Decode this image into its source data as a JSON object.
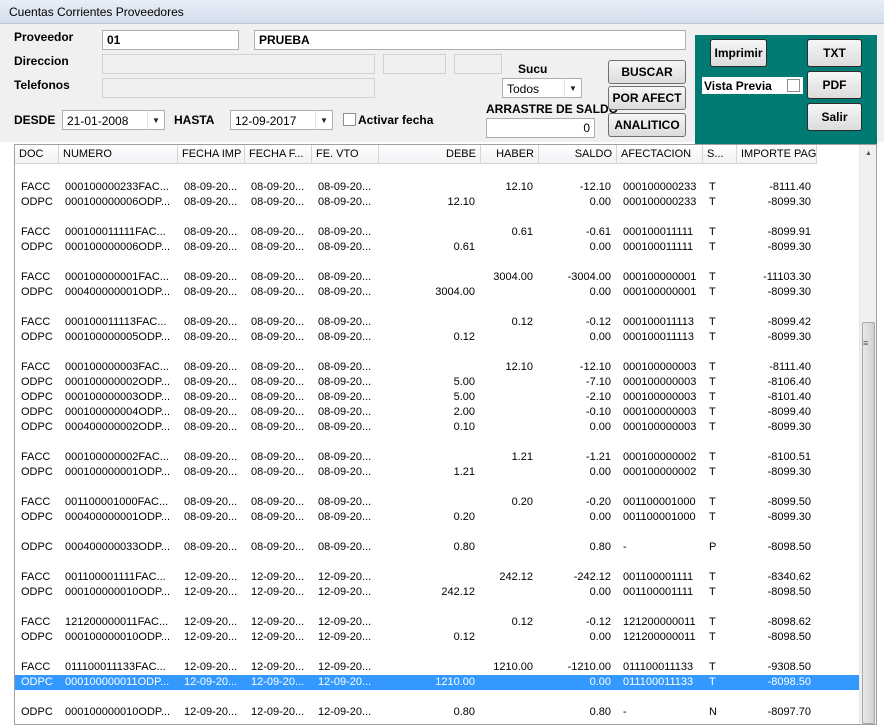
{
  "window": {
    "title": "Cuentas Corrientes Proveedores"
  },
  "form": {
    "proveedor_label": "Proveedor",
    "proveedor_code": "01",
    "proveedor_name": "PRUEBA",
    "direccion_label": "Direccion",
    "telefonos_label": "Telefonos",
    "sucu_label": "Sucu",
    "sucu_value": "Todos",
    "desde_label": "DESDE",
    "desde_value": "21-01-2008",
    "hasta_label": "HASTA",
    "hasta_value": "12-09-2017",
    "activar_fecha_label": "Activar fecha",
    "arrastre_label": "ARRASTRE DE SALDO",
    "arrastre_value": "0",
    "buscar_label": "BUSCAR",
    "por_afect_label": "POR AFECT",
    "analitico_label": "ANALITICO"
  },
  "actions": {
    "imprimir_label": "Imprimir",
    "vista_previa_label": "Vista Previa",
    "txt_label": "TXT",
    "pdf_label": "PDF",
    "salir_label": "Salir"
  },
  "table": {
    "columns": [
      "DOC",
      "NUMERO",
      "FECHA IMP",
      "FECHA F...",
      "FE. VTO",
      "DEBE",
      "HABER",
      "SALDO",
      "AFECTACION",
      "S...",
      "IMPORTE PAG"
    ],
    "rows": [
      [
        "",
        "",
        "",
        "",
        "",
        "",
        "",
        "",
        "",
        "",
        ""
      ],
      [
        "FACC",
        "000100000233FAC...",
        "08-09-20...",
        "08-09-20...",
        "08-09-20...",
        "",
        "12.10",
        "-12.10",
        "000100000233",
        "T",
        "-8111.40"
      ],
      [
        "ODPC",
        "000100000006ODP...",
        "08-09-20...",
        "08-09-20...",
        "08-09-20...",
        "12.10",
        "",
        "0.00",
        "000100000233",
        "T",
        "-8099.30"
      ],
      [
        "",
        "",
        "",
        "",
        "",
        "",
        "",
        "",
        "",
        "",
        ""
      ],
      [
        "FACC",
        "000100011111FAC...",
        "08-09-20...",
        "08-09-20...",
        "08-09-20...",
        "",
        "0.61",
        "-0.61",
        "000100011111",
        "T",
        "-8099.91"
      ],
      [
        "ODPC",
        "000100000006ODP...",
        "08-09-20...",
        "08-09-20...",
        "08-09-20...",
        "0.61",
        "",
        "0.00",
        "000100011111",
        "T",
        "-8099.30"
      ],
      [
        "",
        "",
        "",
        "",
        "",
        "",
        "",
        "",
        "",
        "",
        ""
      ],
      [
        "FACC",
        "000100000001FAC...",
        "08-09-20...",
        "08-09-20...",
        "08-09-20...",
        "",
        "3004.00",
        "-3004.00",
        "000100000001",
        "T",
        "-11103.30"
      ],
      [
        "ODPC",
        "000400000001ODP...",
        "08-09-20...",
        "08-09-20...",
        "08-09-20...",
        "3004.00",
        "",
        "0.00",
        "000100000001",
        "T",
        "-8099.30"
      ],
      [
        "",
        "",
        "",
        "",
        "",
        "",
        "",
        "",
        "",
        "",
        ""
      ],
      [
        "FACC",
        "000100011113FAC...",
        "08-09-20...",
        "08-09-20...",
        "08-09-20...",
        "",
        "0.12",
        "-0.12",
        "000100011113",
        "T",
        "-8099.42"
      ],
      [
        "ODPC",
        "000100000005ODP...",
        "08-09-20...",
        "08-09-20...",
        "08-09-20...",
        "0.12",
        "",
        "0.00",
        "000100011113",
        "T",
        "-8099.30"
      ],
      [
        "",
        "",
        "",
        "",
        "",
        "",
        "",
        "",
        "",
        "",
        ""
      ],
      [
        "FACC",
        "000100000003FAC...",
        "08-09-20...",
        "08-09-20...",
        "08-09-20...",
        "",
        "12.10",
        "-12.10",
        "000100000003",
        "T",
        "-8111.40"
      ],
      [
        "ODPC",
        "000100000002ODP...",
        "08-09-20...",
        "08-09-20...",
        "08-09-20...",
        "5.00",
        "",
        "-7.10",
        "000100000003",
        "T",
        "-8106.40"
      ],
      [
        "ODPC",
        "000100000003ODP...",
        "08-09-20...",
        "08-09-20...",
        "08-09-20...",
        "5.00",
        "",
        "-2.10",
        "000100000003",
        "T",
        "-8101.40"
      ],
      [
        "ODPC",
        "000100000004ODP...",
        "08-09-20...",
        "08-09-20...",
        "08-09-20...",
        "2.00",
        "",
        "-0.10",
        "000100000003",
        "T",
        "-8099.40"
      ],
      [
        "ODPC",
        "000400000002ODP...",
        "08-09-20...",
        "08-09-20...",
        "08-09-20...",
        "0.10",
        "",
        "0.00",
        "000100000003",
        "T",
        "-8099.30"
      ],
      [
        "",
        "",
        "",
        "",
        "",
        "",
        "",
        "",
        "",
        "",
        ""
      ],
      [
        "FACC",
        "000100000002FAC...",
        "08-09-20...",
        "08-09-20...",
        "08-09-20...",
        "",
        "1.21",
        "-1.21",
        "000100000002",
        "T",
        "-8100.51"
      ],
      [
        "ODPC",
        "000100000001ODP...",
        "08-09-20...",
        "08-09-20...",
        "08-09-20...",
        "1.21",
        "",
        "0.00",
        "000100000002",
        "T",
        "-8099.30"
      ],
      [
        "",
        "",
        "",
        "",
        "",
        "",
        "",
        "",
        "",
        "",
        ""
      ],
      [
        "FACC",
        "001100001000FAC...",
        "08-09-20...",
        "08-09-20...",
        "08-09-20...",
        "",
        "0.20",
        "-0.20",
        "001100001000",
        "T",
        "-8099.50"
      ],
      [
        "ODPC",
        "000400000001ODP...",
        "08-09-20...",
        "08-09-20...",
        "08-09-20...",
        "0.20",
        "",
        "0.00",
        "001100001000",
        "T",
        "-8099.30"
      ],
      [
        "",
        "",
        "",
        "",
        "",
        "",
        "",
        "",
        "",
        "",
        ""
      ],
      [
        "ODPC",
        "000400000033ODP...",
        "08-09-20...",
        "08-09-20...",
        "08-09-20...",
        "0.80",
        "",
        "0.80",
        "-",
        "P",
        "-8098.50"
      ],
      [
        "",
        "",
        "",
        "",
        "",
        "",
        "",
        "",
        "",
        "",
        ""
      ],
      [
        "FACC",
        "001100001111FAC...",
        "12-09-20...",
        "12-09-20...",
        "12-09-20...",
        "",
        "242.12",
        "-242.12",
        "001100001111",
        "T",
        "-8340.62"
      ],
      [
        "ODPC",
        "000100000010ODP...",
        "12-09-20...",
        "12-09-20...",
        "12-09-20...",
        "242.12",
        "",
        "0.00",
        "001100001111",
        "T",
        "-8098.50"
      ],
      [
        "",
        "",
        "",
        "",
        "",
        "",
        "",
        "",
        "",
        "",
        ""
      ],
      [
        "FACC",
        "121200000011FAC...",
        "12-09-20...",
        "12-09-20...",
        "12-09-20...",
        "",
        "0.12",
        "-0.12",
        "121200000011",
        "T",
        "-8098.62"
      ],
      [
        "ODPC",
        "000100000010ODP...",
        "12-09-20...",
        "12-09-20...",
        "12-09-20...",
        "0.12",
        "",
        "0.00",
        "121200000011",
        "T",
        "-8098.50"
      ],
      [
        "",
        "",
        "",
        "",
        "",
        "",
        "",
        "",
        "",
        "",
        ""
      ],
      [
        "FACC",
        "011100011133FAC...",
        "12-09-20...",
        "12-09-20...",
        "12-09-20...",
        "",
        "1210.00",
        "-1210.00",
        "011100011133",
        "T",
        "-9308.50"
      ],
      [
        "ODPC",
        "000100000011ODP...",
        "12-09-20...",
        "12-09-20...",
        "12-09-20...",
        "1210.00",
        "",
        "0.00",
        "011100011133",
        "T",
        "-8098.50"
      ],
      [
        "",
        "",
        "",
        "",
        "",
        "",
        "",
        "",
        "",
        "",
        ""
      ],
      [
        "ODPC",
        "000100000010ODP...",
        "12-09-20...",
        "12-09-20...",
        "12-09-20...",
        "0.80",
        "",
        "0.80",
        "-",
        "N",
        "-8097.70"
      ]
    ],
    "selected_row": 34
  },
  "colors": {
    "panel": "#007b73",
    "selection": "#3399ff",
    "window_bg": "#f0f0f0"
  },
  "icons": {
    "dropdown": "chevron-down-icon",
    "scroll_up": "scroll-up-icon",
    "scroll_grip": "scroll-grip-icon"
  }
}
